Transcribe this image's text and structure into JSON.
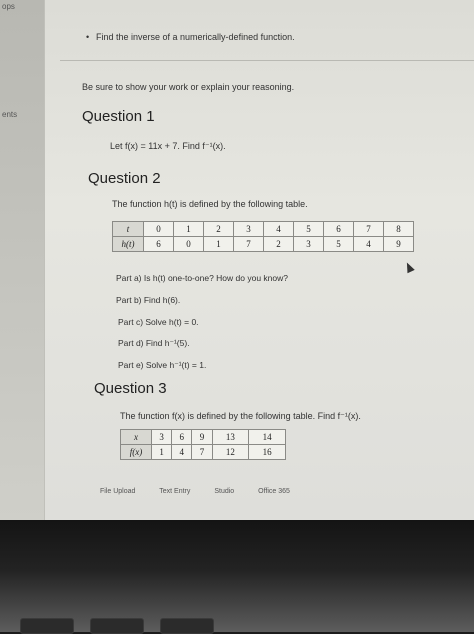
{
  "sidebar": {
    "label_top": "ops",
    "label_mid": "ents"
  },
  "objective": "Find the inverse of a numerically-defined function.",
  "instructions": "Be sure to show your work or explain your reasoning.",
  "q1": {
    "title": "Question 1",
    "prompt": "Let f(x) = 11x + 7. Find f⁻¹(x)."
  },
  "q2": {
    "title": "Question 2",
    "intro": "The function h(t) is defined by the following table.",
    "table": {
      "row1_header": "t",
      "row1": [
        "0",
        "1",
        "2",
        "3",
        "4",
        "5",
        "6",
        "7",
        "8"
      ],
      "row2_header": "h(t)",
      "row2": [
        "6",
        "0",
        "1",
        "7",
        "2",
        "3",
        "5",
        "4",
        "9"
      ]
    },
    "parts": [
      "Part a) Is h(t) one-to-one? How do you know?",
      "Part b) Find h(6).",
      "Part c) Solve h(t) = 0.",
      "Part d) Find h⁻¹(5).",
      "Part e) Solve h⁻¹(t) = 1."
    ]
  },
  "q3": {
    "title": "Question 3",
    "intro": "The function f(x) is defined by the following table. Find f⁻¹(x).",
    "table": {
      "row1_header": "x",
      "row1": [
        "3",
        "6",
        "9",
        "13",
        "14"
      ],
      "row2_header": "f(x)",
      "row2": [
        "1",
        "4",
        "7",
        "12",
        "16"
      ]
    }
  },
  "tabs": [
    "File Upload",
    "Text Entry",
    "Studio",
    "Office 365"
  ]
}
